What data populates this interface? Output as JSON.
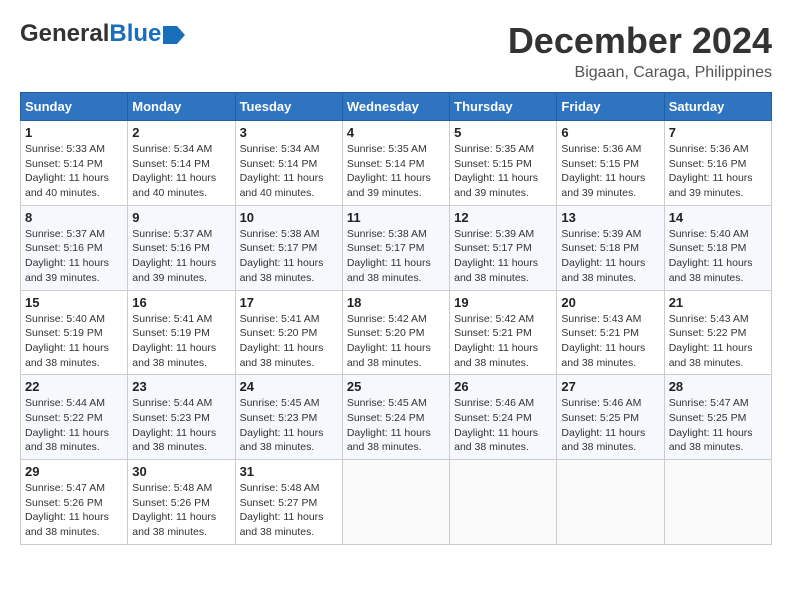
{
  "header": {
    "logo_general": "General",
    "logo_blue": "Blue",
    "month_title": "December 2024",
    "location": "Bigaan, Caraga, Philippines"
  },
  "weekdays": [
    "Sunday",
    "Monday",
    "Tuesday",
    "Wednesday",
    "Thursday",
    "Friday",
    "Saturday"
  ],
  "weeks": [
    [
      {
        "day": 1,
        "sunrise": "5:33 AM",
        "sunset": "5:14 PM",
        "daylight": "11 hours and 40 minutes."
      },
      {
        "day": 2,
        "sunrise": "5:34 AM",
        "sunset": "5:14 PM",
        "daylight": "11 hours and 40 minutes."
      },
      {
        "day": 3,
        "sunrise": "5:34 AM",
        "sunset": "5:14 PM",
        "daylight": "11 hours and 40 minutes."
      },
      {
        "day": 4,
        "sunrise": "5:35 AM",
        "sunset": "5:14 PM",
        "daylight": "11 hours and 39 minutes."
      },
      {
        "day": 5,
        "sunrise": "5:35 AM",
        "sunset": "5:15 PM",
        "daylight": "11 hours and 39 minutes."
      },
      {
        "day": 6,
        "sunrise": "5:36 AM",
        "sunset": "5:15 PM",
        "daylight": "11 hours and 39 minutes."
      },
      {
        "day": 7,
        "sunrise": "5:36 AM",
        "sunset": "5:16 PM",
        "daylight": "11 hours and 39 minutes."
      }
    ],
    [
      {
        "day": 8,
        "sunrise": "5:37 AM",
        "sunset": "5:16 PM",
        "daylight": "11 hours and 39 minutes."
      },
      {
        "day": 9,
        "sunrise": "5:37 AM",
        "sunset": "5:16 PM",
        "daylight": "11 hours and 39 minutes."
      },
      {
        "day": 10,
        "sunrise": "5:38 AM",
        "sunset": "5:17 PM",
        "daylight": "11 hours and 38 minutes."
      },
      {
        "day": 11,
        "sunrise": "5:38 AM",
        "sunset": "5:17 PM",
        "daylight": "11 hours and 38 minutes."
      },
      {
        "day": 12,
        "sunrise": "5:39 AM",
        "sunset": "5:17 PM",
        "daylight": "11 hours and 38 minutes."
      },
      {
        "day": 13,
        "sunrise": "5:39 AM",
        "sunset": "5:18 PM",
        "daylight": "11 hours and 38 minutes."
      },
      {
        "day": 14,
        "sunrise": "5:40 AM",
        "sunset": "5:18 PM",
        "daylight": "11 hours and 38 minutes."
      }
    ],
    [
      {
        "day": 15,
        "sunrise": "5:40 AM",
        "sunset": "5:19 PM",
        "daylight": "11 hours and 38 minutes."
      },
      {
        "day": 16,
        "sunrise": "5:41 AM",
        "sunset": "5:19 PM",
        "daylight": "11 hours and 38 minutes."
      },
      {
        "day": 17,
        "sunrise": "5:41 AM",
        "sunset": "5:20 PM",
        "daylight": "11 hours and 38 minutes."
      },
      {
        "day": 18,
        "sunrise": "5:42 AM",
        "sunset": "5:20 PM",
        "daylight": "11 hours and 38 minutes."
      },
      {
        "day": 19,
        "sunrise": "5:42 AM",
        "sunset": "5:21 PM",
        "daylight": "11 hours and 38 minutes."
      },
      {
        "day": 20,
        "sunrise": "5:43 AM",
        "sunset": "5:21 PM",
        "daylight": "11 hours and 38 minutes."
      },
      {
        "day": 21,
        "sunrise": "5:43 AM",
        "sunset": "5:22 PM",
        "daylight": "11 hours and 38 minutes."
      }
    ],
    [
      {
        "day": 22,
        "sunrise": "5:44 AM",
        "sunset": "5:22 PM",
        "daylight": "11 hours and 38 minutes."
      },
      {
        "day": 23,
        "sunrise": "5:44 AM",
        "sunset": "5:23 PM",
        "daylight": "11 hours and 38 minutes."
      },
      {
        "day": 24,
        "sunrise": "5:45 AM",
        "sunset": "5:23 PM",
        "daylight": "11 hours and 38 minutes."
      },
      {
        "day": 25,
        "sunrise": "5:45 AM",
        "sunset": "5:24 PM",
        "daylight": "11 hours and 38 minutes."
      },
      {
        "day": 26,
        "sunrise": "5:46 AM",
        "sunset": "5:24 PM",
        "daylight": "11 hours and 38 minutes."
      },
      {
        "day": 27,
        "sunrise": "5:46 AM",
        "sunset": "5:25 PM",
        "daylight": "11 hours and 38 minutes."
      },
      {
        "day": 28,
        "sunrise": "5:47 AM",
        "sunset": "5:25 PM",
        "daylight": "11 hours and 38 minutes."
      }
    ],
    [
      {
        "day": 29,
        "sunrise": "5:47 AM",
        "sunset": "5:26 PM",
        "daylight": "11 hours and 38 minutes."
      },
      {
        "day": 30,
        "sunrise": "5:48 AM",
        "sunset": "5:26 PM",
        "daylight": "11 hours and 38 minutes."
      },
      {
        "day": 31,
        "sunrise": "5:48 AM",
        "sunset": "5:27 PM",
        "daylight": "11 hours and 38 minutes."
      },
      null,
      null,
      null,
      null
    ]
  ]
}
